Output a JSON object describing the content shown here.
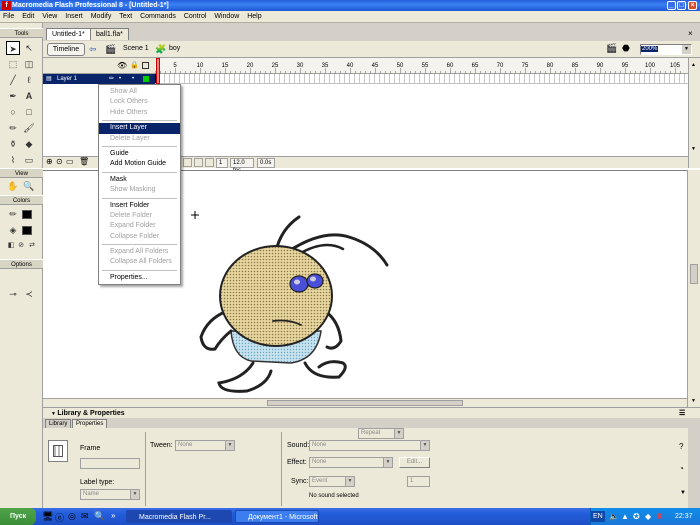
{
  "window": {
    "title": "Macromedia Flash Professional 8 - [Untitled-1*]",
    "min": "_",
    "max": "□",
    "close": "×"
  },
  "menu": [
    "File",
    "Edit",
    "View",
    "Insert",
    "Modify",
    "Text",
    "Commands",
    "Control",
    "Window",
    "Help"
  ],
  "tools": {
    "header": "Tools",
    "view": "View",
    "colors": "Colors",
    "options": "Options"
  },
  "doc": {
    "tabs": [
      "Untitled-1*",
      "ball1.fla*"
    ],
    "timeline_btn": "Timeline",
    "scene": "Scene 1",
    "symbol": "boy",
    "zoom": "200%"
  },
  "timeline": {
    "layer": "Layer 1",
    "ruler": [
      "5",
      "10",
      "15",
      "20",
      "25",
      "30",
      "35",
      "40",
      "45",
      "50",
      "55",
      "60",
      "65",
      "70",
      "75",
      "80",
      "85",
      "90",
      "95",
      "100",
      "105"
    ],
    "frame": "1",
    "fps": "12.0 fps",
    "time": "0.0s"
  },
  "context_menu": {
    "items": [
      {
        "label": "Show All",
        "enabled": false
      },
      {
        "label": "Lock Others",
        "enabled": false
      },
      {
        "label": "Hide Others",
        "enabled": false
      },
      {
        "sep": true
      },
      {
        "label": "Insert Layer",
        "enabled": true,
        "highlighted": true
      },
      {
        "label": "Delete Layer",
        "enabled": false
      },
      {
        "sep": true
      },
      {
        "label": "Guide",
        "enabled": true
      },
      {
        "label": "Add Motion Guide",
        "enabled": true
      },
      {
        "sep": true
      },
      {
        "label": "Mask",
        "enabled": true
      },
      {
        "label": "Show Masking",
        "enabled": false
      },
      {
        "sep": true
      },
      {
        "label": "Insert Folder",
        "enabled": true
      },
      {
        "label": "Delete Folder",
        "enabled": false
      },
      {
        "label": "Expand Folder",
        "enabled": false
      },
      {
        "label": "Collapse Folder",
        "enabled": false
      },
      {
        "sep": true
      },
      {
        "label": "Expand All Folders",
        "enabled": false
      },
      {
        "label": "Collapse All Folders",
        "enabled": false
      },
      {
        "sep": true
      },
      {
        "label": "Properties...",
        "enabled": true
      }
    ]
  },
  "props": {
    "header": "Library & Properties",
    "tabs": [
      "Library",
      "Properties"
    ],
    "frame_label": "Frame",
    "tween_label": "Tween:",
    "tween_value": "None",
    "label_type": "Label type:",
    "label_type_value": "Name",
    "sound_label": "Sound:",
    "sound_value": "None",
    "effect_label": "Effect:",
    "effect_value": "None",
    "edit_btn": "Edit...",
    "sync_label": "Sync:",
    "sync_value": "Event",
    "repeat_value": "Repeat",
    "repeat_count": "1",
    "no_sound": "No sound selected"
  },
  "taskbar": {
    "start": "Пуск",
    "tasks": [
      "Macromedia Flash Pr...",
      "Документ1 - Microsoft ..."
    ],
    "lang": "EN",
    "clock": "22:37"
  },
  "colors": {
    "highlight": "#0a246a",
    "head_fill": "#c8b27a",
    "shorts": "#a9d3e6"
  }
}
